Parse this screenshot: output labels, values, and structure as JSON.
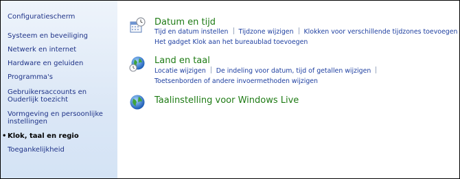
{
  "sidebar": {
    "items": [
      {
        "label": "Configuratiescherm"
      },
      {
        "label": "Systeem en beveiliging"
      },
      {
        "label": "Netwerk en internet"
      },
      {
        "label": "Hardware en geluiden"
      },
      {
        "label": "Programma's"
      },
      {
        "label": "Gebruikersaccounts en Ouderlijk toezicht"
      },
      {
        "label": "Vormgeving en persoonlijke instellingen"
      },
      {
        "label": "Klok, taal en regio",
        "current": true
      },
      {
        "label": "Toegankelijkheid"
      }
    ]
  },
  "categories": [
    {
      "title": "Datum en tijd",
      "icon": "calendar-clock-icon",
      "links_row1": [
        "Tijd en datum instellen",
        "Tijdzone wijzigen",
        "Klokken voor verschillende tijdzones toevoegen"
      ],
      "links_row2": [
        "Het gadget Klok aan het bureaublad toevoegen"
      ]
    },
    {
      "title": "Land en taal",
      "icon": "globe-clock-icon",
      "links_row1": [
        "Locatie wijzigen",
        "De indeling voor datum, tijd of getallen wijzigen"
      ],
      "links_row2": [
        "Toetsenborden of andere invoermethoden wijzigen"
      ]
    },
    {
      "title": "Taalinstelling voor Windows Live",
      "icon": "globe-icon"
    }
  ]
}
